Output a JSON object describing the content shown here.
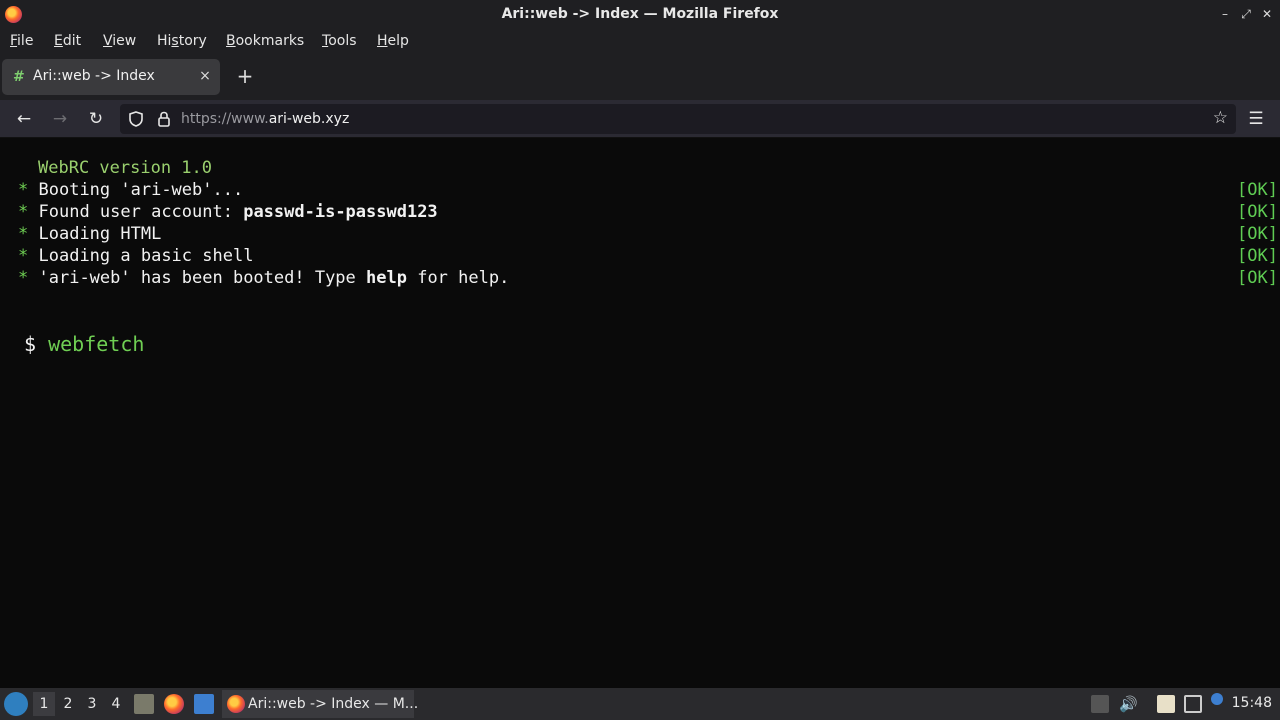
{
  "window": {
    "title": "Ari::web -> Index — Mozilla Firefox"
  },
  "menu": [
    {
      "label": "File",
      "key": "F",
      "rest": "ile"
    },
    {
      "label": "Edit",
      "key": "E",
      "rest": "dit"
    },
    {
      "label": "View",
      "key": "V",
      "rest": "iew"
    },
    {
      "label": "History",
      "pre": "Hi",
      "key": "s",
      "rest": "tory"
    },
    {
      "label": "Bookmarks",
      "key": "B",
      "rest": "ookmarks"
    },
    {
      "label": "Tools",
      "key": "T",
      "rest": "ools"
    },
    {
      "label": "Help",
      "key": "H",
      "rest": "elp"
    }
  ],
  "tab": {
    "title": "Ari::web -> Index",
    "close": "×"
  },
  "newtab": "+",
  "url": {
    "prefix": "https://www.",
    "domain": "ari-web.xyz"
  },
  "terminal": {
    "version": "WebRC version 1.0",
    "star": "*",
    "ok": "[OK]",
    "lines": [
      {
        "pre": "Booting 'ari-web'...",
        "bold": "",
        "post": ""
      },
      {
        "pre": "Found user account: ",
        "bold": "passwd-is-passwd123",
        "post": ""
      },
      {
        "pre": "Loading HTML",
        "bold": "",
        "post": ""
      },
      {
        "pre": "Loading a basic shell",
        "bold": "",
        "post": ""
      },
      {
        "pre": "'ari-web' has been booted! Type ",
        "bold": "help",
        "post": " for help."
      }
    ],
    "prompt_symbol": "$",
    "command": "webfetch"
  },
  "taskbar": {
    "workspaces": [
      "1",
      "2",
      "3",
      "4"
    ],
    "active_workspace": "1",
    "task_title": "Ari::web -> Index — M...",
    "clock": "15:48"
  }
}
